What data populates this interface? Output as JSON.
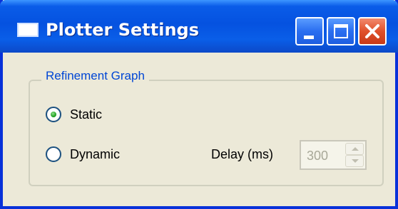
{
  "window": {
    "title": "Plotter Settings",
    "icon": "window-icon",
    "controls": [
      "minimize-icon",
      "maximize-icon",
      "close-icon"
    ]
  },
  "group": {
    "label": "Refinement Graph",
    "options": [
      {
        "label": "Static",
        "selected": true
      },
      {
        "label": "Dynamic",
        "selected": false
      }
    ],
    "delay": {
      "label": "Delay (ms)",
      "value": "300",
      "enabled": false
    }
  },
  "colors": {
    "titlebar": "#0552e0",
    "group_label": "#0046d5",
    "radio_dot": "#21a121",
    "close_button": "#e0502a"
  }
}
